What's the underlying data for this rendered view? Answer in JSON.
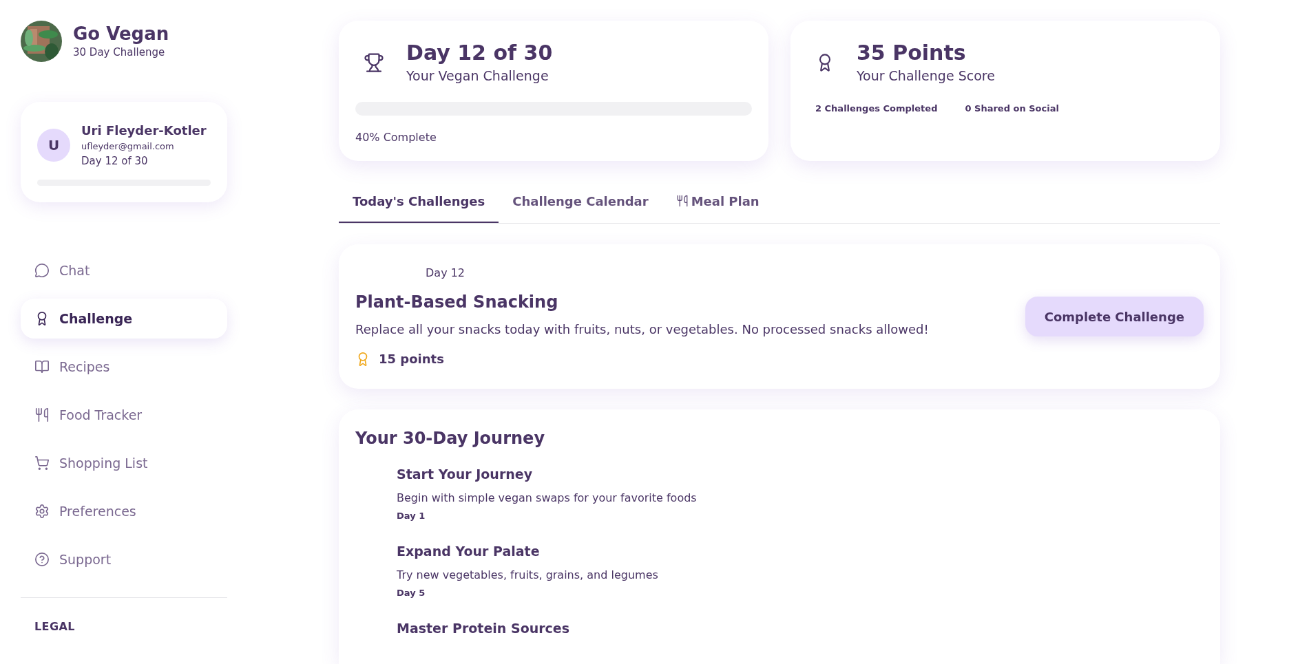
{
  "brand": {
    "title": "Go Vegan",
    "subtitle": "30 Day Challenge"
  },
  "user": {
    "initial": "U",
    "name": "Uri Fleyder-Kotler",
    "email": "ufleyder@gmail.com",
    "day": "Day 12 of 30"
  },
  "nav": [
    {
      "kind": "chat",
      "label": "Chat",
      "selected": false
    },
    {
      "kind": "award",
      "label": "Challenge",
      "selected": true
    },
    {
      "kind": "book",
      "label": "Recipes",
      "selected": false
    },
    {
      "kind": "utensils",
      "label": "Food Tracker",
      "selected": false
    },
    {
      "kind": "cart",
      "label": "Shopping List",
      "selected": false
    },
    {
      "kind": "gear",
      "label": "Preferences",
      "selected": false
    },
    {
      "kind": "help",
      "label": "Support",
      "selected": false
    }
  ],
  "legal_heading": "LEGAL",
  "progress_card": {
    "title": "Day 12 of 30",
    "subtitle": "Your Vegan Challenge",
    "reading": "40% Complete"
  },
  "score_card": {
    "title": "35 Points",
    "subtitle": "Your Challenge Score",
    "stats": [
      "2 Challenges Completed",
      "0 Shared on Social"
    ]
  },
  "tabs": [
    {
      "label": "Today's Challenges",
      "selected": true,
      "icon": false
    },
    {
      "label": "Challenge Calendar",
      "selected": false,
      "icon": false
    },
    {
      "label": "Meal Plan",
      "selected": false,
      "icon": true
    }
  ],
  "challenge": {
    "day": "Day 12",
    "title": "Plant-Based Snacking",
    "description": "Replace all your snacks today with fruits, nuts, or vegetables. No processed snacks allowed!",
    "points": "15 points",
    "button": "Complete Challenge"
  },
  "journey": {
    "title": "Your 30-Day Journey",
    "items": [
      {
        "title": "Start Your Journey",
        "description": "Begin with simple vegan swaps for your favorite foods",
        "day": "Day 1"
      },
      {
        "title": "Expand Your Palate",
        "description": "Try new vegetables, fruits, grains, and legumes",
        "day": "Day 5"
      },
      {
        "title": "Master Protein Sources"
      }
    ]
  }
}
